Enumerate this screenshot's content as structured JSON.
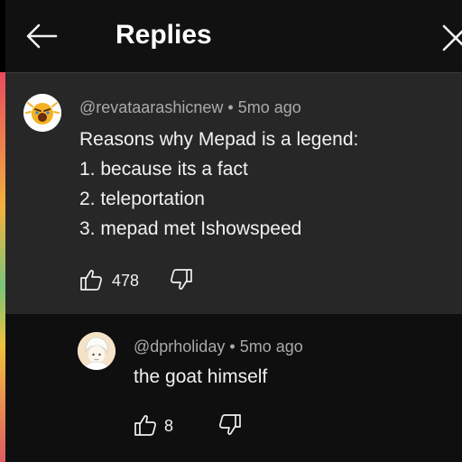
{
  "header": {
    "title": "Replies"
  },
  "parent_comment": {
    "author": "@revataarashicnew",
    "age": "5mo ago",
    "lines": [
      "Reasons why Mepad is a legend:",
      "1. because its a fact",
      "2. teleportation",
      "3. mepad met Ishowspeed"
    ],
    "likes": "478"
  },
  "reply_comment": {
    "author": "@dprholiday",
    "age": "5mo ago",
    "text": "the goat himself",
    "likes": "8"
  },
  "separator": "•",
  "colors": {
    "background": "#0f0f0f",
    "highlight": "#272727",
    "secondary_text": "#aaaaaa"
  },
  "icons": [
    "back-arrow-icon",
    "close-icon",
    "thumbs-up-icon",
    "thumbs-down-icon"
  ]
}
